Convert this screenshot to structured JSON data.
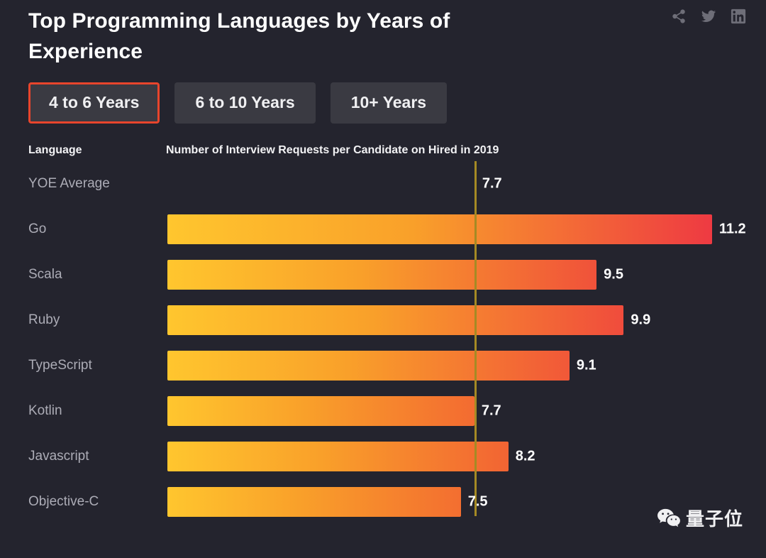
{
  "header": {
    "title": "Top Programming Languages by Years of Experience",
    "social": [
      {
        "name": "share-icon",
        "label": "Share"
      },
      {
        "name": "twitter-icon",
        "label": "Twitter"
      },
      {
        "name": "linkedin-icon",
        "label": "LinkedIn"
      }
    ]
  },
  "tabs": [
    {
      "label": "4 to 6 Years",
      "selected": true
    },
    {
      "label": "6 to 10 Years",
      "selected": false
    },
    {
      "label": "10+ Years",
      "selected": false
    }
  ],
  "columns": {
    "language": "Language",
    "metric": "Number of Interview Requests per Candidate on Hired in 2019"
  },
  "watermark": {
    "text": "量子位",
    "icon": "wechat-icon"
  },
  "colors": {
    "background": "#24242e",
    "accent": "#e8452c",
    "reference_line": "#a58a24",
    "bar_start": "#ffc62e",
    "bar_end_max": "#ee3a42",
    "label": "#acacb6",
    "value": "#ffffff"
  },
  "chart_data": {
    "type": "bar",
    "title": "Top Programming Languages by Years of Experience",
    "subtitle": "4 to 6 Years",
    "xlabel": "Number of Interview Requests per Candidate on Hired in 2019",
    "ylabel": "Language",
    "orientation": "horizontal",
    "grid": false,
    "legend": null,
    "reference_line": {
      "label": "YOE Average",
      "value": 7.7
    },
    "xlim": [
      0,
      11.6
    ],
    "categories": [
      "YOE Average",
      "Go",
      "Scala",
      "Ruby",
      "TypeScript",
      "Kotlin",
      "Javascript",
      "Objective-C"
    ],
    "values": [
      7.7,
      11.2,
      9.5,
      9.9,
      9.1,
      7.7,
      8.2,
      7.5
    ],
    "rows": [
      {
        "label": "YOE Average",
        "value": 7.7,
        "value_text": "7.7",
        "is_reference": true
      },
      {
        "label": "Go",
        "value": 11.2,
        "value_text": "11.2",
        "is_reference": false
      },
      {
        "label": "Scala",
        "value": 9.5,
        "value_text": "9.5",
        "is_reference": false
      },
      {
        "label": "Ruby",
        "value": 9.9,
        "value_text": "9.9",
        "is_reference": false
      },
      {
        "label": "TypeScript",
        "value": 9.1,
        "value_text": "9.1",
        "is_reference": false
      },
      {
        "label": "Kotlin",
        "value": 7.7,
        "value_text": "7.7",
        "is_reference": false
      },
      {
        "label": "Javascript",
        "value": 8.2,
        "value_text": "8.2",
        "is_reference": false
      },
      {
        "label": "Objective-C",
        "value": 7.5,
        "value_text": "7.5",
        "is_reference": false
      }
    ]
  }
}
